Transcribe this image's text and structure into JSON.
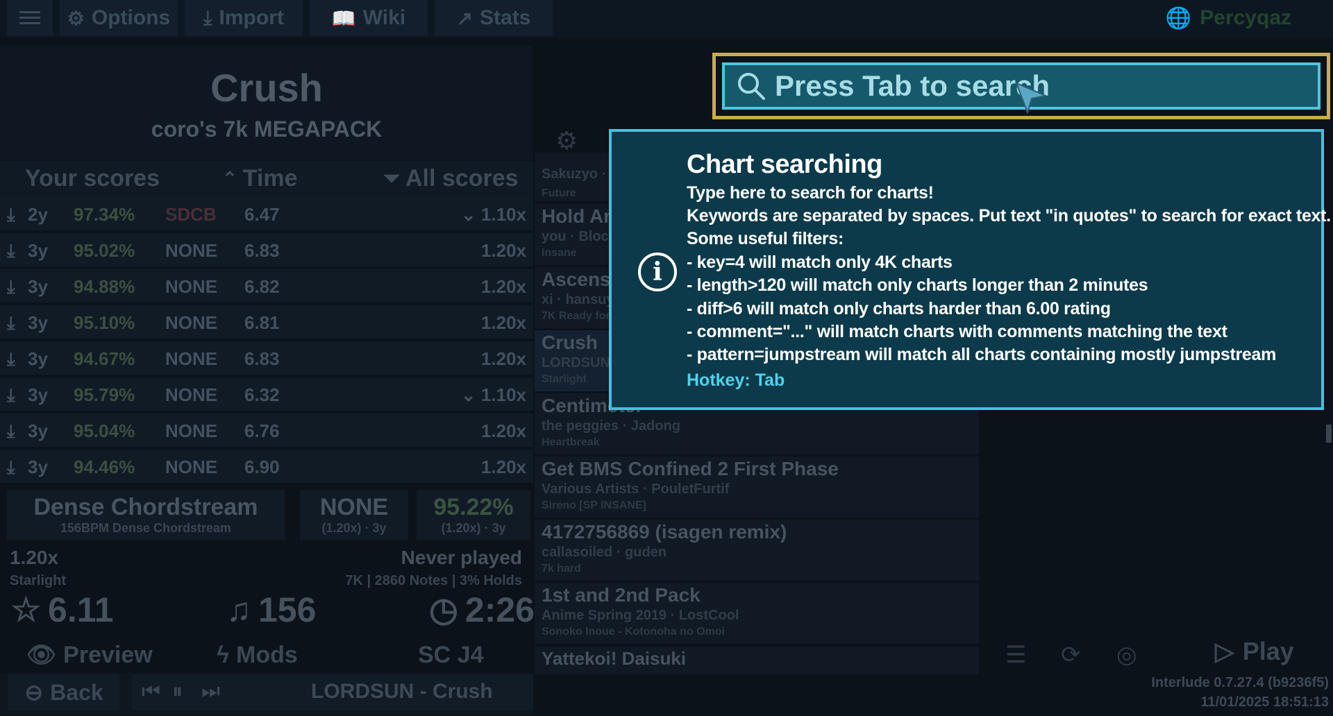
{
  "topbar": {
    "menu_icon": "hamburger-icon",
    "options_label": "Options",
    "import_label": "Import",
    "wiki_label": "Wiki",
    "stats_label": "Stats",
    "username": "Percyqaz"
  },
  "song": {
    "title": "Crush",
    "pack": "coro's 7k MEGAPACK"
  },
  "scores": {
    "your_scores_label": "Your scores",
    "sort_label": "Time",
    "filter_label": "All scores",
    "rows": [
      {
        "age": "2y",
        "accuracy": "97.34%",
        "grade": "SDCB",
        "rating": "6.47",
        "rate": "1.10x"
      },
      {
        "age": "3y",
        "accuracy": "95.02%",
        "grade": "NONE",
        "rating": "6.83",
        "rate": "1.20x"
      },
      {
        "age": "3y",
        "accuracy": "94.88%",
        "grade": "NONE",
        "rating": "6.82",
        "rate": "1.20x"
      },
      {
        "age": "3y",
        "accuracy": "95.10%",
        "grade": "NONE",
        "rating": "6.81",
        "rate": "1.20x"
      },
      {
        "age": "3y",
        "accuracy": "94.67%",
        "grade": "NONE",
        "rating": "6.83",
        "rate": "1.20x"
      },
      {
        "age": "3y",
        "accuracy": "95.79%",
        "grade": "NONE",
        "rating": "6.32",
        "rate": "1.10x"
      },
      {
        "age": "3y",
        "accuracy": "95.04%",
        "grade": "NONE",
        "rating": "6.76",
        "rate": "1.20x"
      },
      {
        "age": "3y",
        "accuracy": "94.46%",
        "grade": "NONE",
        "rating": "6.90",
        "rate": "1.20x"
      }
    ]
  },
  "chart_info": {
    "pattern": "Dense Chordstream",
    "pattern_detail": "156BPM Dense Chordstream",
    "grade": "NONE",
    "grade_detail": "(1.20x) · 3y",
    "best_acc": "95.22%",
    "best_acc_detail": "(1.20x) · 3y",
    "rate": "1.20x",
    "difficulty_name": "Starlight",
    "play_status": "Never played",
    "notes_info": "7K | 2860 Notes | 3% Holds",
    "rating": "6.11",
    "bpm": "156",
    "length": "2:26",
    "ruleset": "SC J4"
  },
  "actions": {
    "preview_label": "Preview",
    "mods_label": "Mods",
    "back_label": "Back",
    "now_playing": "LORDSUN - Crush",
    "play_label": "Play"
  },
  "song_list": [
    {
      "title": "Sakuzyo · S",
      "artist": "Future",
      "diff": ""
    },
    {
      "title": "Hold Ange",
      "artist": "you · Block",
      "diff": "Insane"
    },
    {
      "title": "Ascension",
      "artist": "xi · hansuy",
      "diff": "7K Ready for s"
    },
    {
      "title": "Crush",
      "artist": "LORDSUN ·",
      "diff": "Starlight"
    },
    {
      "title": "Centimeter",
      "artist": "the peggies · Jadong",
      "diff": "Heartbreak"
    },
    {
      "title": "Get BMS Confined 2 First Phase",
      "artist": "Various Artists · PouletFurtif",
      "diff": "Sireno [SP INSANE]"
    },
    {
      "title": "4172756869 (isagen remix)",
      "artist": "callasoiled · guden",
      "diff": "7k hard"
    },
    {
      "title": "1st and 2nd Pack",
      "artist": "Anime Spring 2019 · LostCool",
      "diff": "Sonoko Inoue - Kotonoha no Omoi"
    },
    {
      "title": "Yattekoi! Daisuki",
      "artist": "",
      "diff": ""
    }
  ],
  "search": {
    "placeholder": "Press Tab to search"
  },
  "tooltip": {
    "title": "Chart searching",
    "lines": [
      "Type here to search for charts!",
      "Keywords are separated by spaces. Put text \"in quotes\" to search for exact text.",
      "Some useful filters:",
      "- key=4 will match only 4K charts",
      "- length>120 will match only charts longer than 2 minutes",
      "- diff>6 will match only charts harder than 6.00 rating",
      "- comment=\"...\" will match charts with comments matching the text",
      "- pattern=jumpstream will match all charts containing mostly jumpstream"
    ],
    "hotkey": "Hotkey: Tab"
  },
  "footer": {
    "version": "Interlude 0.7.27.4 (b9236f5)",
    "datetime": "11/01/2025 18:51:13"
  },
  "colors": {
    "search_bg": "#16596a",
    "search_border": "#4ac7de",
    "focus_frame": "#c9ac4e",
    "tooltip_bg": "#0c3a4b",
    "hotkey": "#4fd3ea"
  }
}
